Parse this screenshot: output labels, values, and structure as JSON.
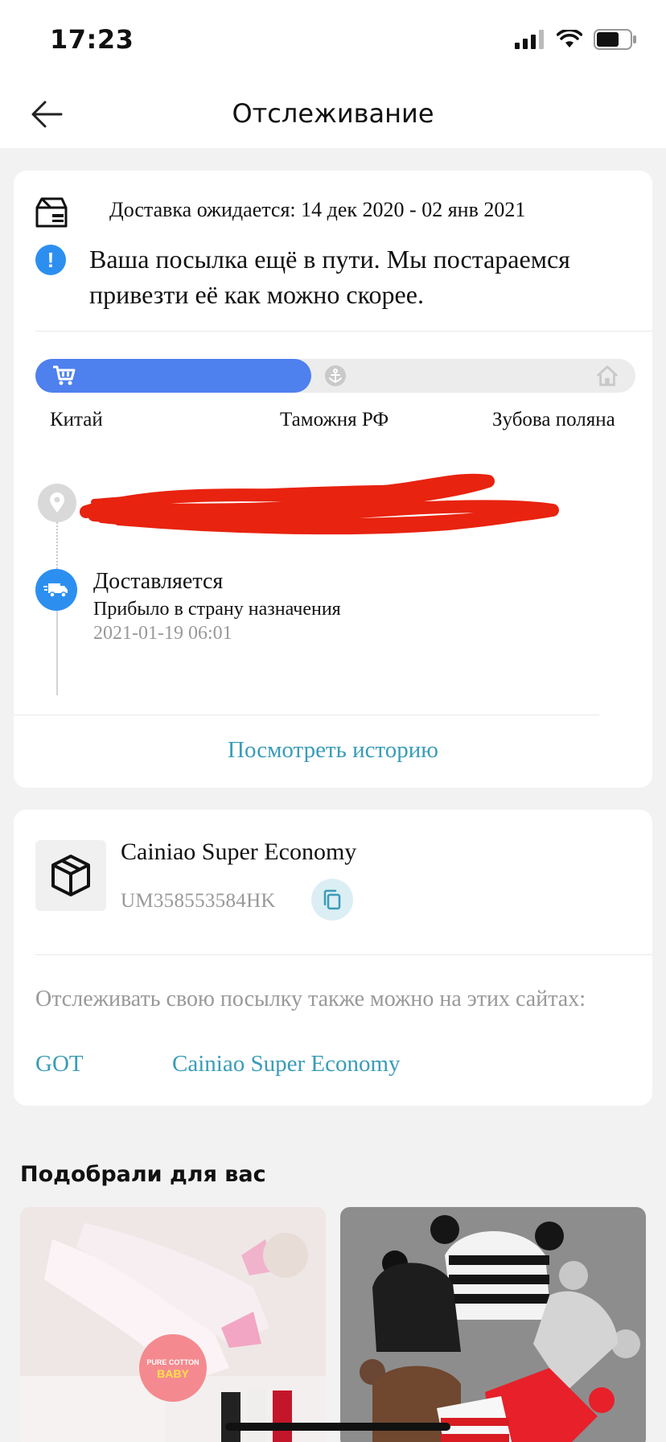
{
  "status_bar": {
    "time": "17:23"
  },
  "header": {
    "title": "Отслеживание"
  },
  "tracking": {
    "eta": "Доставка ожидается: 14 дек 2020 - 02 янв 2021",
    "notice": "Ваша посылка ещё в пути. Мы постараемся привезти её как можно скорее.",
    "progress_fraction": 0.46,
    "stages": [
      "Китай",
      "Таможня РФ",
      "Зубова поляна"
    ],
    "event": {
      "status": "Доставляется",
      "description": "Прибыло в страну назначения",
      "timestamp": "2021-01-19 06:01"
    },
    "history_link": "Посмотреть историю"
  },
  "carrier": {
    "name": "Cainiao Super Economy",
    "tracking_number": "UM358553584HK",
    "also_track_text": "Отслеживать свою посылку также можно на этих сайтах:",
    "sites": [
      "GOT",
      "Cainiao Super Economy"
    ]
  },
  "recommendations": {
    "title": "Подобрали для вас",
    "badge": "PURE COTTON BABY"
  },
  "colors": {
    "accent_blue": "#2c8ff0",
    "progress_blue": "#4e80ee",
    "link_teal": "#3a9cb8",
    "redaction_red": "#e8230f"
  }
}
